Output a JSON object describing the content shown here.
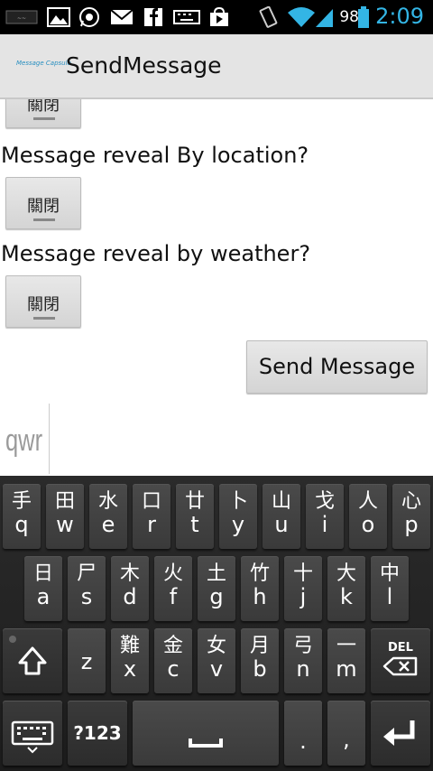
{
  "status_bar": {
    "battery": "98",
    "time": "2:09",
    "icons": [
      "app-icon",
      "image-icon",
      "whatsapp-icon",
      "gmail-icon",
      "facebook-icon",
      "keyboard-icon",
      "play-store-icon",
      "vibrate-icon",
      "wifi-icon",
      "signal-icon",
      "battery-icon"
    ]
  },
  "action_bar": {
    "logo_text": "Message Capsule",
    "title": "SendMessage"
  },
  "content": {
    "toggle_partial_label": "關閉",
    "question_location": "Message reveal By location?",
    "toggle_location_label": "關閉",
    "question_weather": "Message reveal by weather?",
    "toggle_weather_label": "關閉",
    "send_button": "Send Message"
  },
  "candidate": {
    "word": "qwr"
  },
  "keyboard": {
    "row1": [
      {
        "top": "手",
        "bot": "q"
      },
      {
        "top": "田",
        "bot": "w"
      },
      {
        "top": "水",
        "bot": "e"
      },
      {
        "top": "口",
        "bot": "r"
      },
      {
        "top": "廿",
        "bot": "t"
      },
      {
        "top": "卜",
        "bot": "y"
      },
      {
        "top": "山",
        "bot": "u"
      },
      {
        "top": "戈",
        "bot": "i"
      },
      {
        "top": "人",
        "bot": "o"
      },
      {
        "top": "心",
        "bot": "p"
      }
    ],
    "row2": [
      {
        "top": "日",
        "bot": "a"
      },
      {
        "top": "尸",
        "bot": "s"
      },
      {
        "top": "木",
        "bot": "d"
      },
      {
        "top": "火",
        "bot": "f"
      },
      {
        "top": "土",
        "bot": "g"
      },
      {
        "top": "竹",
        "bot": "h"
      },
      {
        "top": "十",
        "bot": "j"
      },
      {
        "top": "大",
        "bot": "k"
      },
      {
        "top": "中",
        "bot": "l"
      }
    ],
    "row3": [
      {
        "top": "",
        "bot": "z"
      },
      {
        "top": "難",
        "bot": "x"
      },
      {
        "top": "金",
        "bot": "c"
      },
      {
        "top": "女",
        "bot": "v"
      },
      {
        "top": "月",
        "bot": "b"
      },
      {
        "top": "弓",
        "bot": "n"
      },
      {
        "top": "一",
        "bot": "m"
      }
    ],
    "del_label": "DEL",
    "num_label": "?123",
    "period": ".",
    "comma": ","
  },
  "colors": {
    "accent": "#33b5e5",
    "keyboard_bg": "#1c1c1c",
    "key": "#444444"
  }
}
